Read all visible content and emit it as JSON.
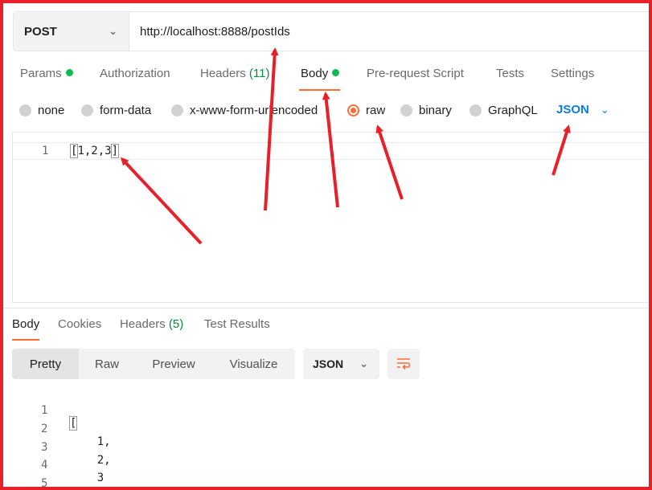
{
  "request": {
    "method": "POST",
    "url": "http://localhost:8888/postIds"
  },
  "request_tabs": [
    {
      "label": "Params",
      "dot": true
    },
    {
      "label": "Authorization"
    },
    {
      "label": "Headers",
      "count": "(11)"
    },
    {
      "label": "Body",
      "dot": true,
      "active": true
    },
    {
      "label": "Pre-request Script"
    },
    {
      "label": "Tests"
    },
    {
      "label": "Settings"
    }
  ],
  "body_types": [
    {
      "label": "none"
    },
    {
      "label": "form-data"
    },
    {
      "label": "x-www-form-urlencoded"
    },
    {
      "label": "raw",
      "selected": true
    },
    {
      "label": "binary"
    },
    {
      "label": "GraphQL"
    }
  ],
  "body_format": "JSON",
  "editor": {
    "line_number": "1",
    "content": "[1,2,3]"
  },
  "response_tabs": [
    {
      "label": "Body",
      "active": true
    },
    {
      "label": "Cookies"
    },
    {
      "label": "Headers",
      "count": "(5)"
    },
    {
      "label": "Test Results"
    }
  ],
  "view_modes": [
    "Pretty",
    "Raw",
    "Preview",
    "Visualize"
  ],
  "active_view_mode": "Pretty",
  "response_format": "JSON",
  "response_lines": [
    {
      "n": "1",
      "text": "["
    },
    {
      "n": "2",
      "text": "    1,"
    },
    {
      "n": "3",
      "text": "    2,"
    },
    {
      "n": "4",
      "text": "    3"
    },
    {
      "n": "5",
      "text": "]"
    }
  ],
  "colors": {
    "accent": "#ff6c37",
    "success_dot": "#0cbb52",
    "link_blue": "#097bed",
    "annotation_red": "#e8202a"
  }
}
